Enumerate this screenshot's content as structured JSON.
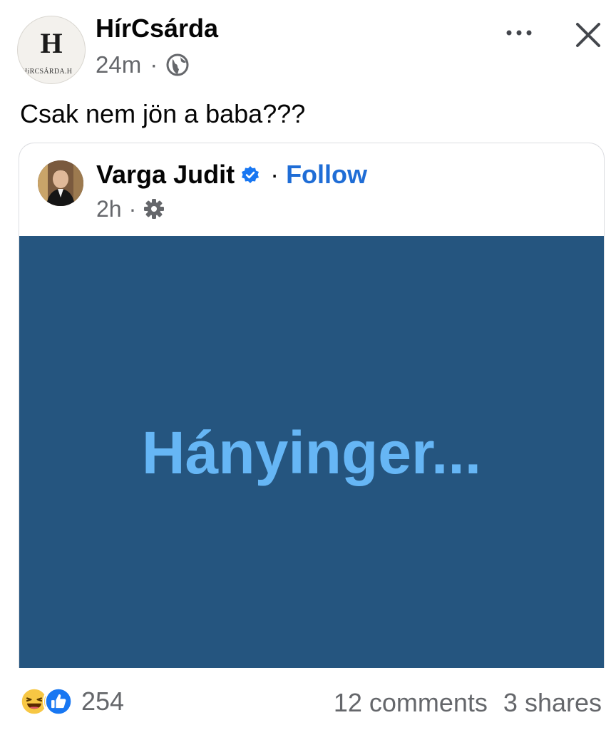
{
  "post": {
    "page_name": "HírCsárda",
    "time": "24m",
    "separator": "·",
    "audience_icon": "globe-icon",
    "caption": "Csak nem jön a baba???",
    "avatar": {
      "monogram": "H",
      "subtext": "HíRCSÁRDA.H"
    }
  },
  "shared": {
    "author": "Varga Judit",
    "separator": "·",
    "follow_label": "Follow",
    "time": "2h",
    "audience_icon": "gear-icon",
    "image_text": "Hányinger..."
  },
  "footer": {
    "reaction_count": "254",
    "comments": "12 comments",
    "shares": "3 shares"
  },
  "colors": {
    "image_background": "#25557f",
    "image_text": "#66b6f5",
    "follow": "#1f6dd6",
    "meta_gray": "#65676b",
    "like_blue": "#1877f2",
    "haha_yellow": "#f7c744"
  }
}
